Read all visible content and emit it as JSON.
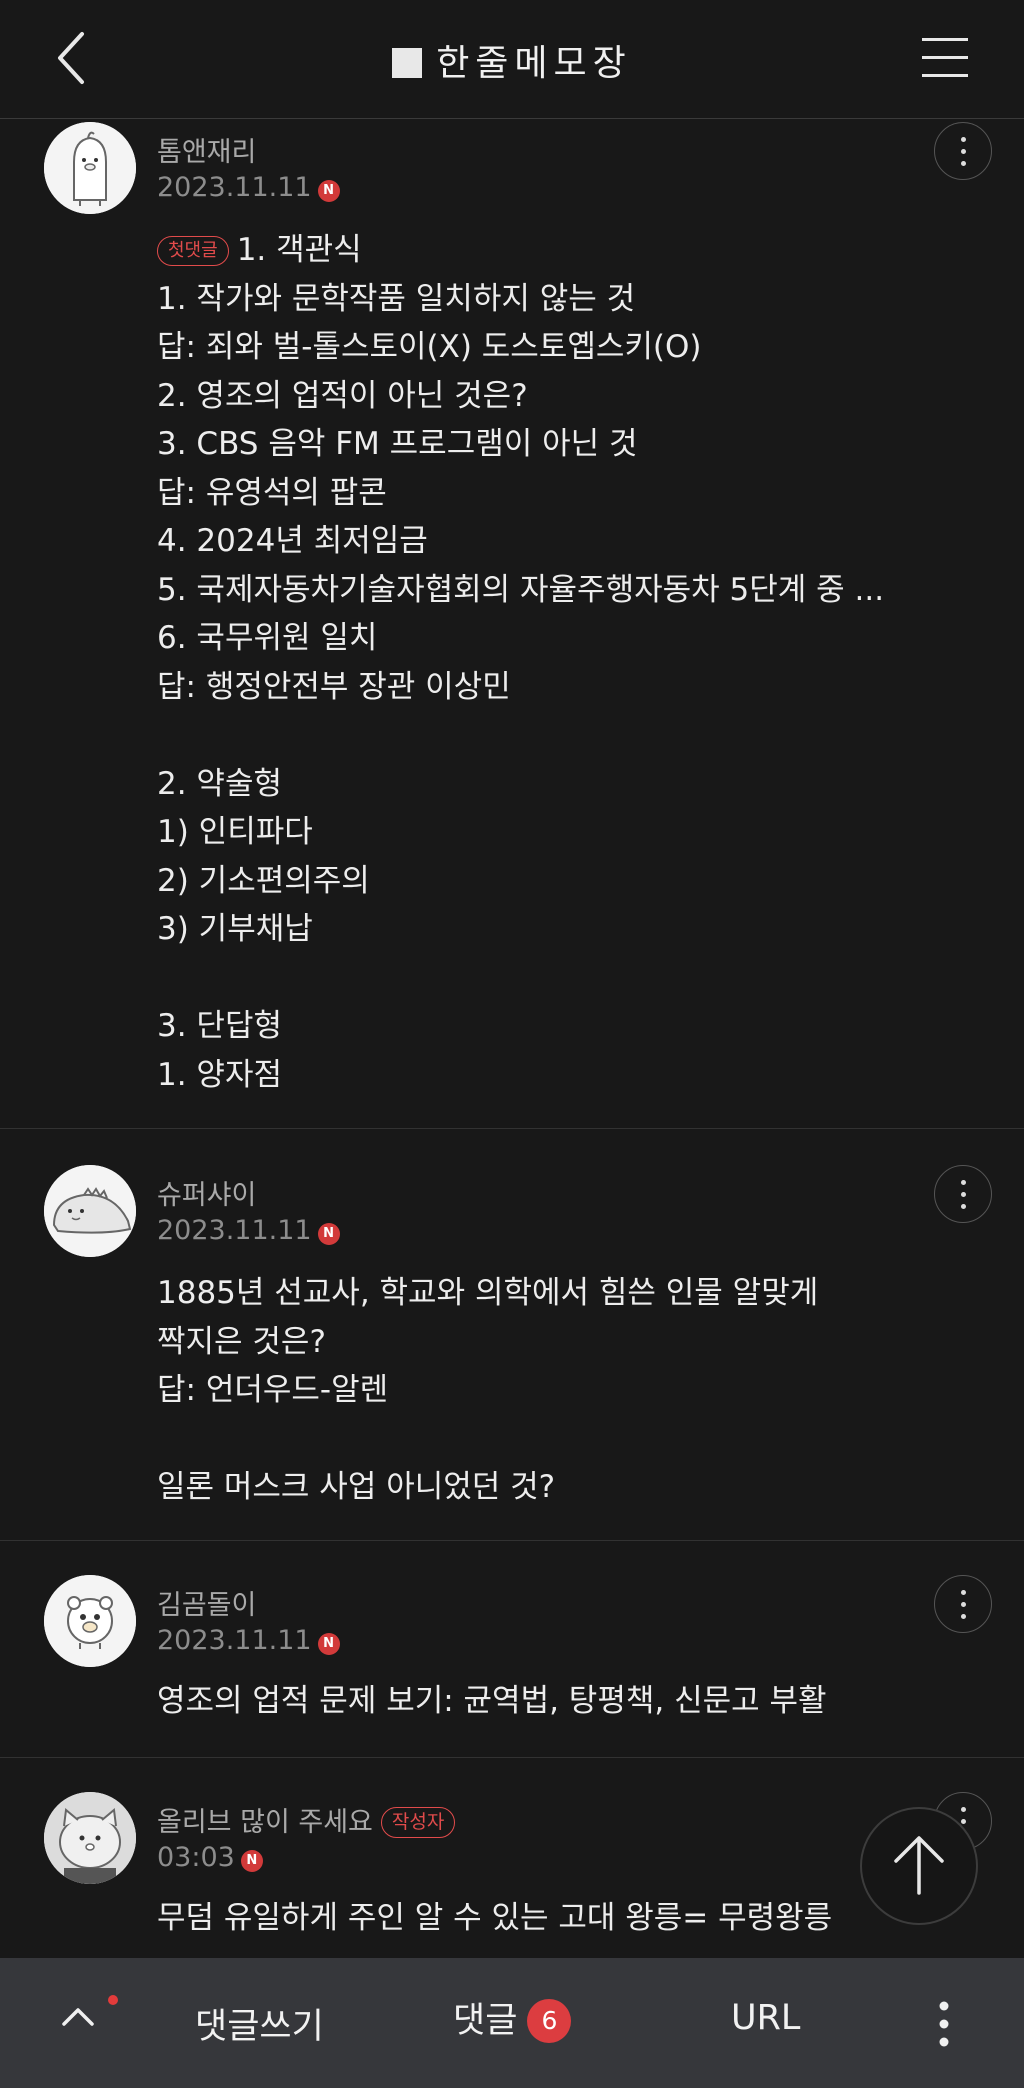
{
  "header": {
    "title": "한줄메모장"
  },
  "comments": [
    {
      "nickname": "톰앤재리",
      "date": "2023.11.11",
      "new_badge": "N",
      "tag": "첫댓글",
      "lines": [
        "1. 객관식",
        "1. 작가와 문학작품 일치하지 않는 것",
        "답: 죄와 벌-톨스토이(X) 도스토옙스키(O)",
        "2. 영조의 업적이 아닌 것은?",
        "3. CBS 음악 FM 프로그램이 아닌 것",
        "답: 유영석의 팝콘",
        "4. 2024년 최저임금",
        "5. 국제자동차기술자협회의 자율주행자동차 5단계 중 ...",
        "6. 국무위원 일치",
        "답: 행정안전부 장관 이상민",
        "",
        "2. 약술형",
        "1) 인티파다",
        "2) 기소편의주의",
        "3) 기부채납",
        "",
        "3. 단답형",
        "1. 양자점"
      ]
    },
    {
      "nickname": "슈퍼샤이",
      "date": "2023.11.11",
      "new_badge": "N",
      "lines": [
        "1885년 선교사, 학교와 의학에서 힘쓴 인물 알맞게",
        "짝지은 것은?",
        "답: 언더우드-알렌",
        "",
        "일론 머스크 사업 아니었던 것?"
      ]
    },
    {
      "nickname": "김곰돌이",
      "date": "2023.11.11",
      "new_badge": "N",
      "lines": [
        "영조의 업적 문제 보기: 균역법, 탕평책, 신문고 부활"
      ]
    },
    {
      "nickname": "올리브 많이 주세요",
      "writer_tag": "작성자",
      "date": "03:03",
      "new_badge": "N",
      "lines": [
        "무덤 유일하게 주인 알 수 있는 고대 왕릉= 무령왕릉"
      ]
    }
  ],
  "bottom_bar": {
    "write_label": "댓글쓰기",
    "comments_label": "댓글",
    "comments_count": "6",
    "url_label": "URL"
  },
  "icons": [
    "back-icon",
    "menu-icon",
    "more-icon",
    "scroll-top-icon",
    "chevron-up-icon",
    "kebab-icon"
  ]
}
